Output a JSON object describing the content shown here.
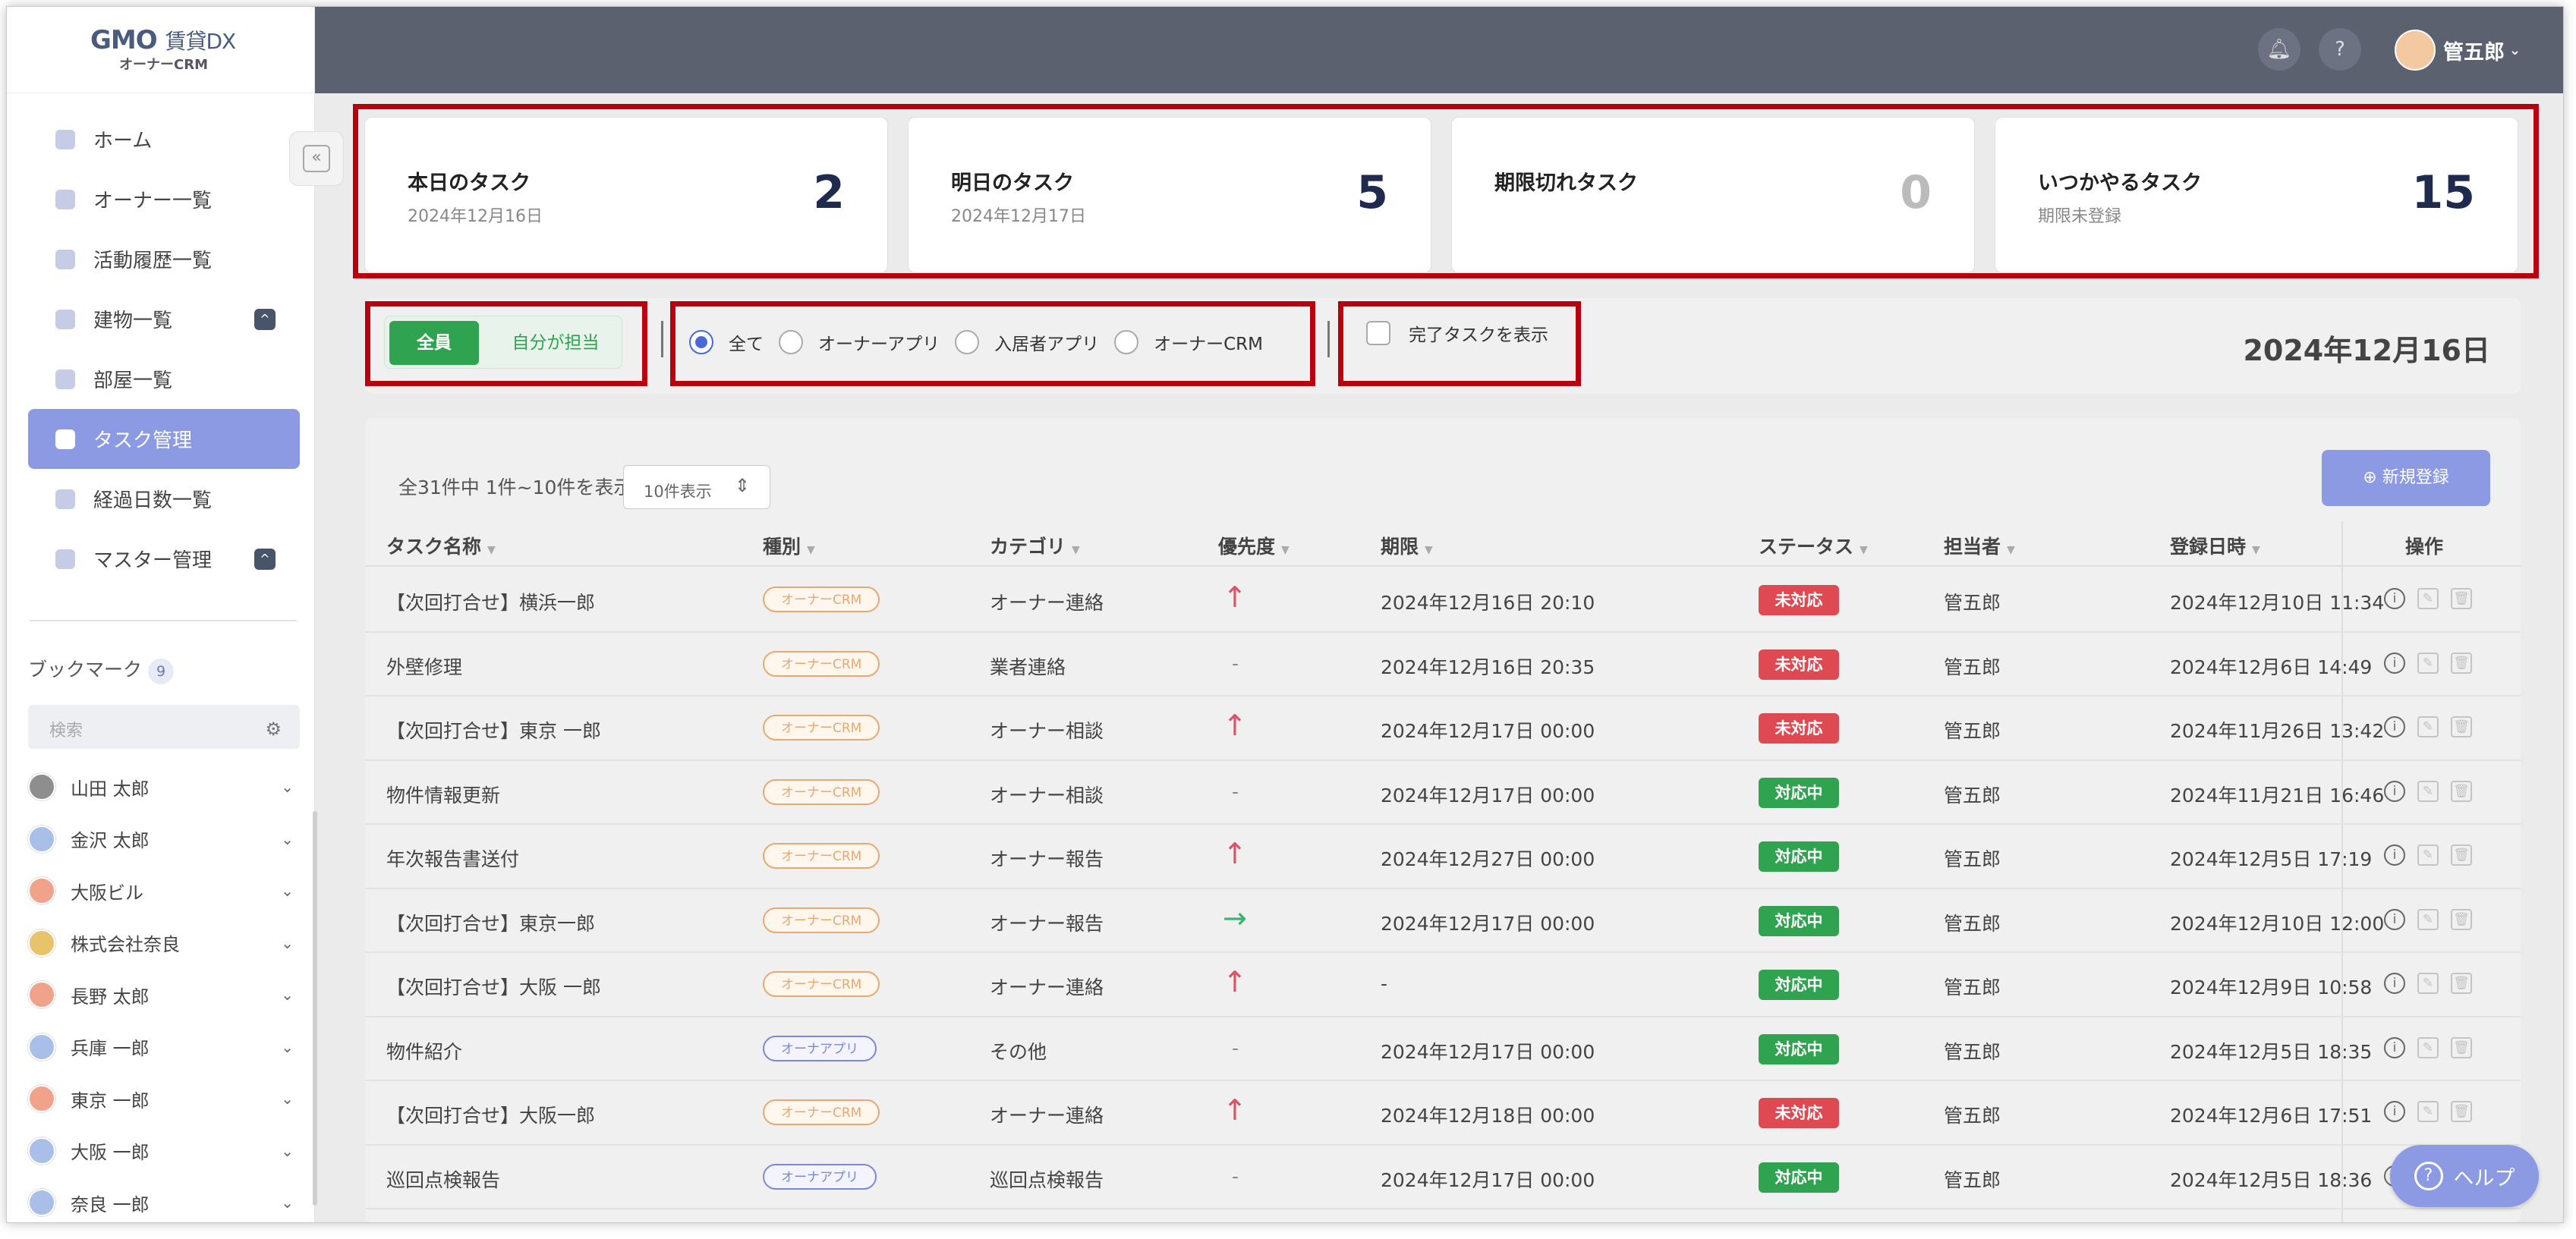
{
  "logo": {
    "brand": "GMO",
    "product": "賃貸DX",
    "sub": "オーナーCRM"
  },
  "sidebar": {
    "nav": [
      {
        "label": "ホーム"
      },
      {
        "label": "オーナー一覧"
      },
      {
        "label": "活動履歴一覧"
      },
      {
        "label": "建物一覧",
        "expand": "^"
      },
      {
        "label": "部屋一覧"
      },
      {
        "label": "タスク管理"
      },
      {
        "label": "経過日数一覧"
      },
      {
        "label": "マスター管理",
        "expand": "^"
      }
    ],
    "bookmark_title": "ブックマーク",
    "bookmark_count": "9",
    "bookmark_search_placeholder": "検索",
    "bookmarks": [
      {
        "label": "山田 太郎",
        "color": "#8e8e8e"
      },
      {
        "label": "金沢 太郎",
        "color": "#a9bfe8"
      },
      {
        "label": "大阪ビル",
        "color": "#f0a38a"
      },
      {
        "label": "株式会社奈良",
        "color": "#e8c36a"
      },
      {
        "label": "長野 太郎",
        "color": "#f0a38a"
      },
      {
        "label": "兵庫 一郎",
        "color": "#a9bfe8"
      },
      {
        "label": "東京 一郎",
        "color": "#f0a38a"
      },
      {
        "label": "大阪 一郎",
        "color": "#a9bfe8"
      },
      {
        "label": "奈良 一郎",
        "color": "#a9bfe8"
      }
    ]
  },
  "header": {
    "user_name": "管五郎",
    "bell_icon": "bell-icon",
    "help_icon": "question-icon"
  },
  "summary": [
    {
      "title": "本日のタスク",
      "sub": "2024年12月16日",
      "value": "2"
    },
    {
      "title": "明日のタスク",
      "sub": "2024年12月17日",
      "value": "5"
    },
    {
      "title": "期限切れタスク",
      "sub": "",
      "value": "0"
    },
    {
      "title": "いつかやるタスク",
      "sub": "期限未登録",
      "value": "15"
    }
  ],
  "filters": {
    "assignee_all": "全員",
    "assignee_mine": "自分が担当",
    "source_options": [
      "全て",
      "オーナーアプリ",
      "入居者アプリ",
      "オーナーCRM"
    ],
    "source_selected": "全て",
    "show_done": "完了タスクを表示",
    "date": "2024年12月16日"
  },
  "table": {
    "count_text": "全31件中 1件~10件を表示",
    "per_page": "10件表示",
    "new_button": "新規登録",
    "headers": [
      "タスク名称",
      "種別",
      "カテゴリ",
      "優先度",
      "期限",
      "ステータス",
      "担当者",
      "登録日時",
      "操作"
    ],
    "rows": [
      {
        "name": "【次回打合せ】横浜一郎",
        "type": "オーナーCRM",
        "category": "オーナー連絡",
        "priority": "high",
        "due": "2024年12月16日 20:10",
        "status": "未対応",
        "assignee": "管五郎",
        "created": "2024年12月10日 11:34"
      },
      {
        "name": "外壁修理",
        "type": "オーナーCRM",
        "category": "業者連絡",
        "priority": "none",
        "due": "2024年12月16日 20:35",
        "status": "未対応",
        "assignee": "管五郎",
        "created": "2024年12月6日 14:49"
      },
      {
        "name": "【次回打合せ】東京 一郎",
        "type": "オーナーCRM",
        "category": "オーナー相談",
        "priority": "high",
        "due": "2024年12月17日 00:00",
        "status": "未対応",
        "assignee": "管五郎",
        "created": "2024年11月26日 13:42"
      },
      {
        "name": "物件情報更新",
        "type": "オーナーCRM",
        "category": "オーナー相談",
        "priority": "none",
        "due": "2024年12月17日 00:00",
        "status": "対応中",
        "assignee": "管五郎",
        "created": "2024年11月21日 16:46"
      },
      {
        "name": "年次報告書送付",
        "type": "オーナーCRM",
        "category": "オーナー報告",
        "priority": "high",
        "due": "2024年12月27日 00:00",
        "status": "対応中",
        "assignee": "管五郎",
        "created": "2024年12月5日 17:19"
      },
      {
        "name": "【次回打合せ】東京一郎",
        "type": "オーナーCRM",
        "category": "オーナー報告",
        "priority": "mid",
        "due": "2024年12月17日 00:00",
        "status": "対応中",
        "assignee": "管五郎",
        "created": "2024年12月10日 12:00"
      },
      {
        "name": "【次回打合せ】大阪 一郎",
        "type": "オーナーCRM",
        "category": "オーナー連絡",
        "priority": "high",
        "due": "-",
        "status": "対応中",
        "assignee": "管五郎",
        "created": "2024年12月9日 10:58"
      },
      {
        "name": "物件紹介",
        "type": "オーナアプリ",
        "category": "その他",
        "priority": "none",
        "due": "2024年12月17日 00:00",
        "status": "対応中",
        "assignee": "管五郎",
        "created": "2024年12月5日 18:35"
      },
      {
        "name": "【次回打合せ】大阪一郎",
        "type": "オーナーCRM",
        "category": "オーナー連絡",
        "priority": "high",
        "due": "2024年12月18日 00:00",
        "status": "未対応",
        "assignee": "管五郎",
        "created": "2024年12月6日 17:51"
      },
      {
        "name": "巡回点検報告",
        "type": "オーナアプリ",
        "category": "巡回点検報告",
        "priority": "none",
        "due": "2024年12月17日 00:00",
        "status": "対応中",
        "assignee": "管五郎",
        "created": "2024年12月5日 18:36"
      }
    ]
  },
  "help_button": "ヘルプ"
}
